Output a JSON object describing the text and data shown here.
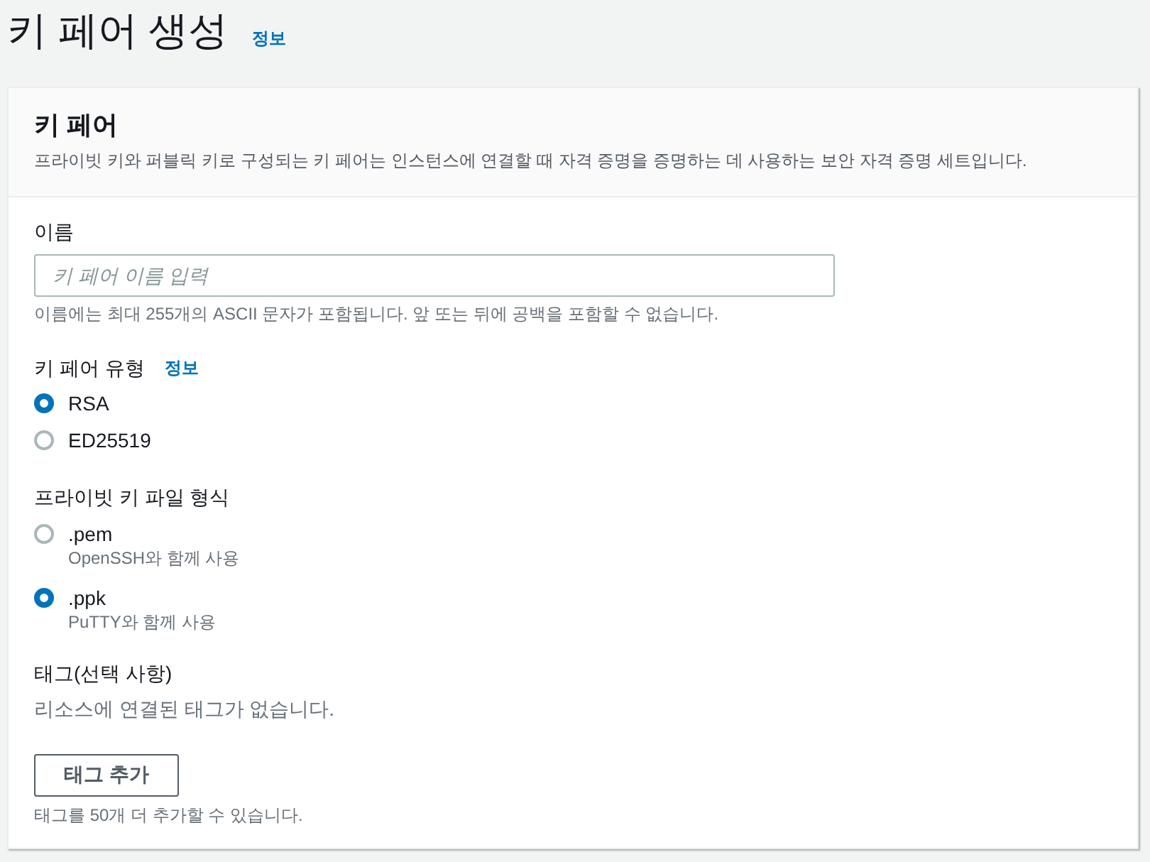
{
  "page": {
    "title": "키 페어 생성",
    "info_link": "정보"
  },
  "card": {
    "title": "키 페어",
    "description": "프라이빗 키와 퍼블릭 키로 구성되는 키 페어는 인스턴스에 연결할 때 자격 증명을 증명하는 데 사용하는 보안 자격 증명 세트입니다."
  },
  "name_field": {
    "label": "이름",
    "placeholder": "키 페어 이름 입력",
    "hint": "이름에는 최대 255개의 ASCII 문자가 포함됩니다. 앞 또는 뒤에 공백을 포함할 수 없습니다."
  },
  "key_pair_type": {
    "label": "키 페어 유형",
    "info_link": "정보",
    "options": [
      {
        "label": "RSA",
        "selected": true
      },
      {
        "label": "ED25519",
        "selected": false
      }
    ]
  },
  "private_key_format": {
    "label": "프라이빗 키 파일 형식",
    "options": [
      {
        "label": ".pem",
        "description": "OpenSSH와 함께 사용",
        "selected": false
      },
      {
        "label": ".ppk",
        "description": "PuTTY와 함께 사용",
        "selected": true
      }
    ]
  },
  "tags": {
    "label": "태그(선택 사항)",
    "empty_text": "리소스에 연결된 태그가 없습니다.",
    "add_button": "태그 추가",
    "hint": "태그를 50개 더 추가할 수 있습니다."
  }
}
